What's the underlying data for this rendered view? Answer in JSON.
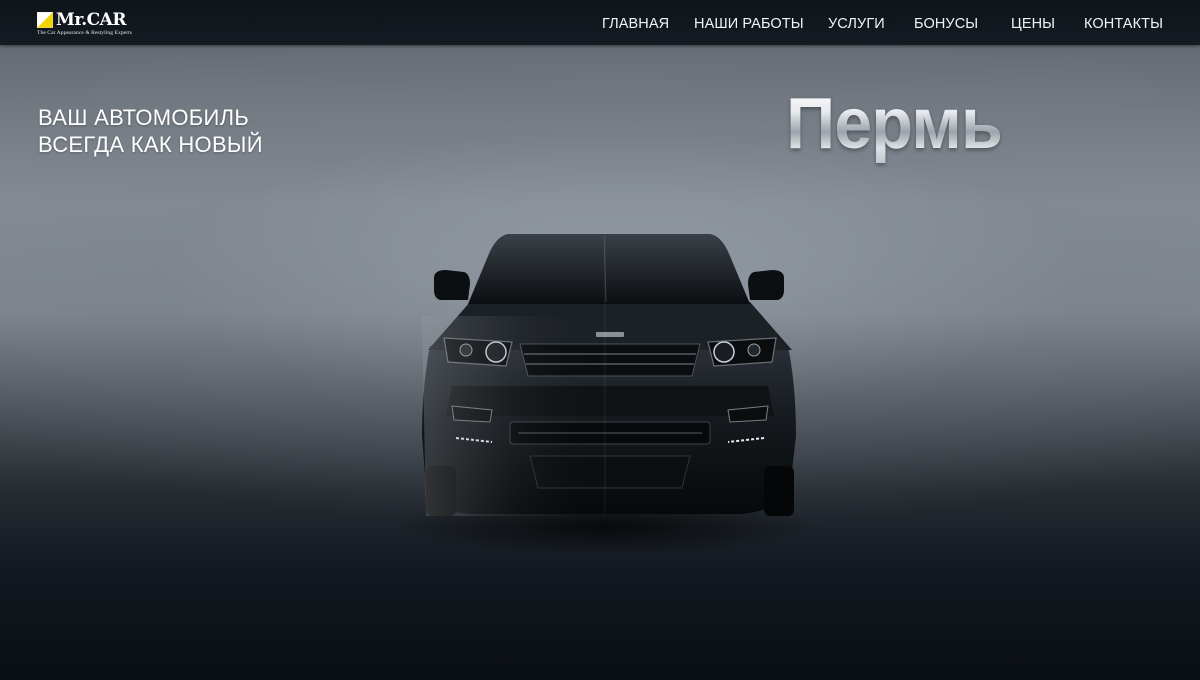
{
  "brand": {
    "name": "Mr.CAR",
    "tagline": "The Car Appearance & Restyling Experts",
    "colors": {
      "yellow": "#f2d400",
      "bar": "#10161c"
    }
  },
  "nav": {
    "items": [
      {
        "label": "ГЛАВНАЯ"
      },
      {
        "label": "НАШИ РАБОТЫ"
      },
      {
        "label": "УСЛУГИ"
      },
      {
        "label": "БОНУСЫ"
      },
      {
        "label": "ЦЕНЫ"
      },
      {
        "label": "КОНТАКТЫ"
      }
    ]
  },
  "hero": {
    "line1": "ВАШ АВТОМОБИЛЬ",
    "line2": "ВСЕГДА КАК НОВЫЙ",
    "city": "Пермь"
  },
  "icons": {
    "logo": "yellow-triangle-logo-icon",
    "car": "black-suv-front-view-image"
  }
}
